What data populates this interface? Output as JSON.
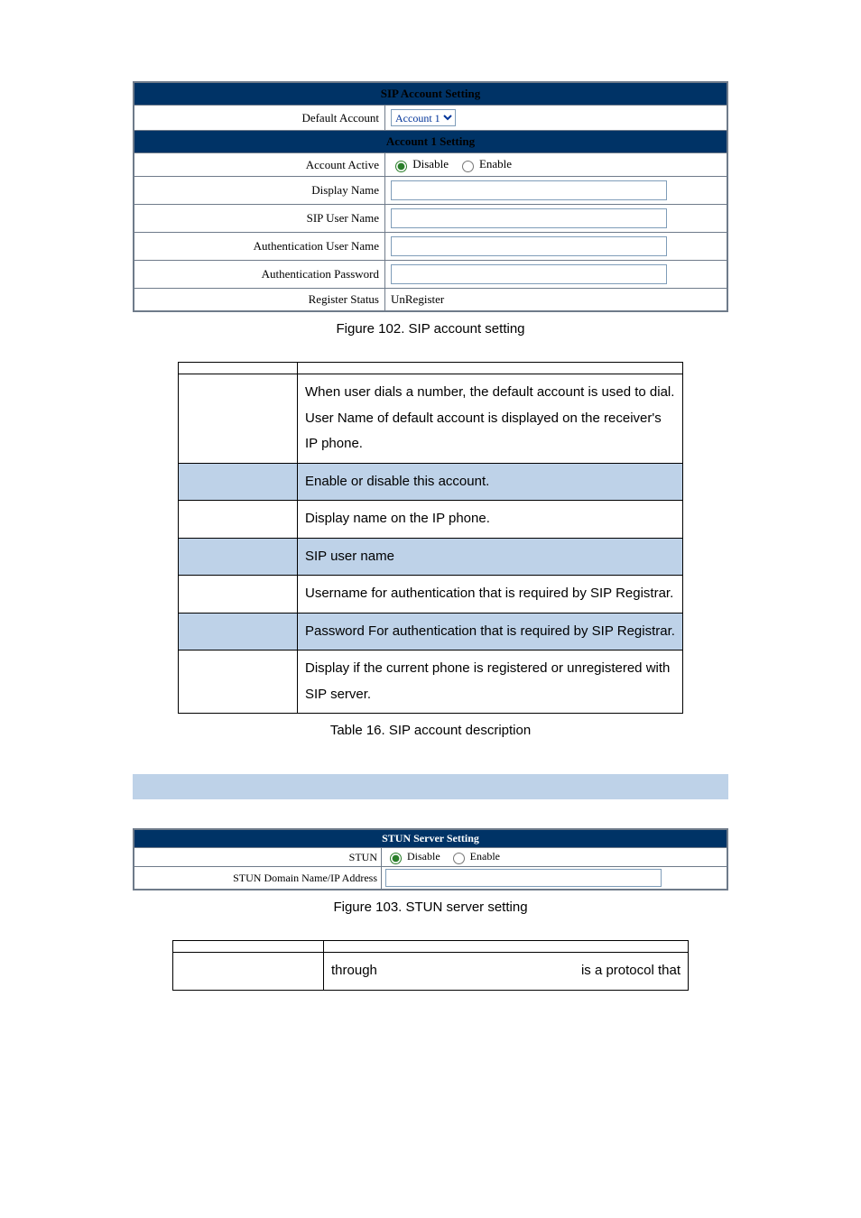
{
  "sip": {
    "header": "SIP Account Setting",
    "default_account_label": "Default Account",
    "default_account_value": "Account 1",
    "account1_header": "Account 1 Setting",
    "rows": {
      "account_active_label": "Account Active",
      "disable_label": "Disable",
      "enable_label": "Enable",
      "display_name_label": "Display Name",
      "sip_user_name_label": "SIP User Name",
      "auth_user_label": "Authentication User Name",
      "auth_pass_label": "Authentication Password",
      "register_status_label": "Register Status",
      "register_status_value": "UnRegister"
    }
  },
  "captions": {
    "fig102": "Figure 102. SIP account setting",
    "tbl16": "Table 16. SIP account description",
    "fig103": "Figure 103. STUN server setting"
  },
  "desc": [
    "When user dials a number, the default account is used to dial. User Name of default account is displayed on the receiver's IP phone.",
    "Enable or disable this account.",
    "Display name on the IP phone.",
    "SIP user name",
    "Username for authentication that is required by SIP Registrar.",
    "Password For authentication that is required by SIP Registrar.",
    "Display if the current phone is registered or unregistered with SIP server."
  ],
  "stun": {
    "header": "STUN Server Setting",
    "stun_label": "STUN",
    "disable_label": "Disable",
    "enable_label": "Enable",
    "domain_label": "STUN Domain Name/IP Address"
  },
  "stun_desc": {
    "left": "through",
    "right": "is a protocol that"
  }
}
